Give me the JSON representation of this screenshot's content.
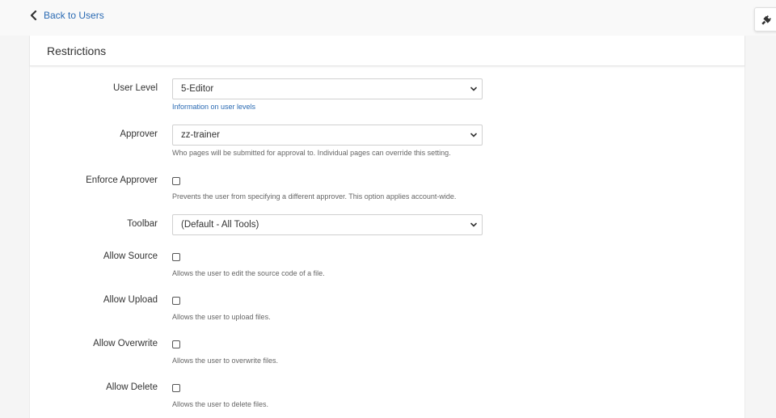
{
  "nav": {
    "back_label": "Back to Users"
  },
  "panel": {
    "title": "Restrictions"
  },
  "fields": {
    "user_level": {
      "label": "User Level",
      "value": "5-Editor",
      "help_link": "Information on user levels"
    },
    "approver": {
      "label": "Approver",
      "value": "zz-trainer",
      "help": "Who pages will be submitted for approval to. Individual pages can override this setting."
    },
    "enforce_approver": {
      "label": "Enforce Approver",
      "checked": false,
      "help": "Prevents the user from specifying a different approver. This option applies account-wide."
    },
    "toolbar": {
      "label": "Toolbar",
      "value": "(Default - All Tools)"
    },
    "allow_source": {
      "label": "Allow Source",
      "checked": false,
      "help": "Allows the user to edit the source code of a file."
    },
    "allow_upload": {
      "label": "Allow Upload",
      "checked": false,
      "help": "Allows the user to upload files."
    },
    "allow_overwrite": {
      "label": "Allow Overwrite",
      "checked": false,
      "help": "Allows the user to overwrite files."
    },
    "allow_delete": {
      "label": "Allow Delete",
      "checked": false,
      "help": "Allows the user to delete files."
    }
  },
  "colors": {
    "link": "#2a6ab3",
    "text": "#333333",
    "muted": "#666666",
    "background": "#f5f5f5"
  },
  "icons": {
    "back": "chevron-left-icon",
    "plugin": "plug-icon",
    "dropdown": "chevron-down-icon"
  }
}
